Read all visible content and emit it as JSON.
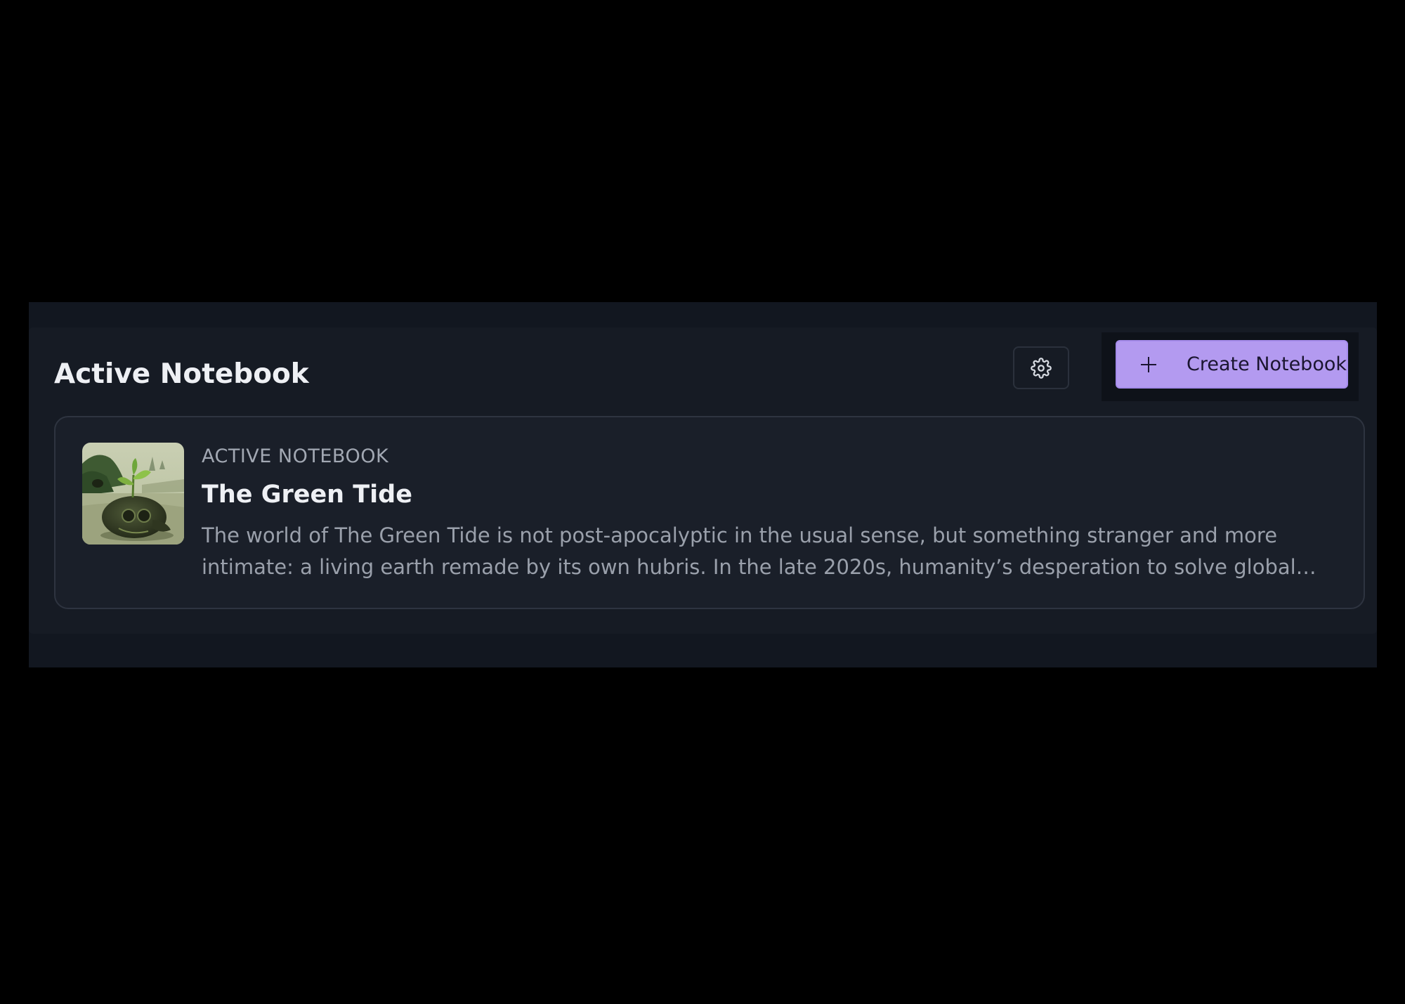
{
  "section": {
    "title": "Active Notebook"
  },
  "toolbar": {
    "settings_icon": "gear-icon",
    "create_label": "Create Notebook",
    "create_icon": "plus-icon"
  },
  "notebook": {
    "eyebrow": "ACTIVE NOTEBOOK",
    "title": "The Green Tide",
    "description_line1": "The world of The Green Tide is not post-apocalyptic in the usual sense, but something stranger and more",
    "description_line2": "intimate: a living earth remade by its own hubris. In the late 2020s, humanity’s desperation to solve global…",
    "cover_icon": "notebook-cover-image"
  },
  "colors": {
    "background": "#000000",
    "panel": "#161b24",
    "card": "#1a1f29",
    "accent": "#b39af0",
    "title_text": "#eef0f4",
    "muted_text": "#9aa0ab"
  }
}
